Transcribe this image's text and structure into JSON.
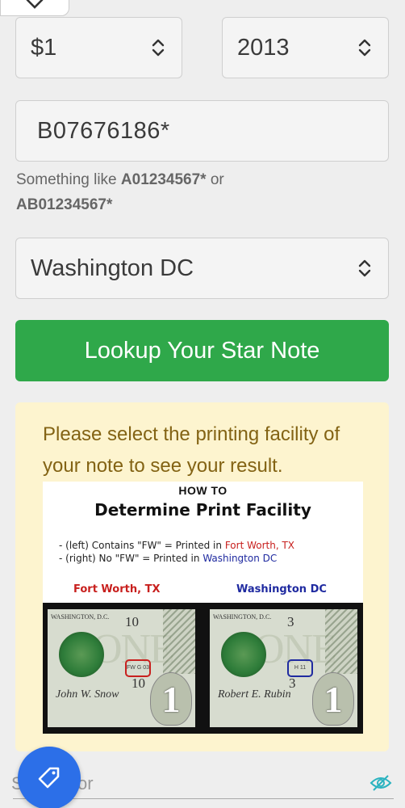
{
  "denomination": {
    "value": "$1"
  },
  "year": {
    "value": "2013"
  },
  "serial": {
    "value": "B07676186*"
  },
  "hint": {
    "prefix": "Something like ",
    "example1": "A01234567*",
    "middle": " or",
    "example2": "AB01234567*"
  },
  "facility": {
    "value": "Washington DC"
  },
  "lookup_button": {
    "label": "Lookup Your Star Note"
  },
  "notice": {
    "message": "Please select the printing facility of your note to see your result."
  },
  "guide": {
    "howto": "HOW TO",
    "title": "Determine Print Facility",
    "line1_prefix": "- (left) Contains \"FW\" = Printed in ",
    "line1_place": "Fort Worth, TX",
    "line2_prefix": "- (right) No \"FW\" = Printed in ",
    "line2_place": "Washington DC",
    "left_label": "Fort Worth, TX",
    "right_label": "Washington DC",
    "left_bill": {
      "bank": "WASHINGTON, D.C.",
      "number": "10",
      "box": "FW G 03",
      "sig": "John W. Snow"
    },
    "right_bill": {
      "bank": "WASHINGTON, D.C.",
      "number": "3",
      "box": "H 11",
      "sig": "Robert E. Rubin"
    },
    "bill_value": "1"
  },
  "search": {
    "first_char": "S",
    "placeholder_tail": "or"
  },
  "colors": {
    "accent_green": "#2fa84a",
    "fab_blue": "#2c6fe8",
    "notice_bg": "#fdf4cf",
    "notice_text": "#836314"
  },
  "icons": [
    "chevron-down-icon",
    "select-arrows-icon",
    "tag-icon",
    "eye-icon"
  ]
}
